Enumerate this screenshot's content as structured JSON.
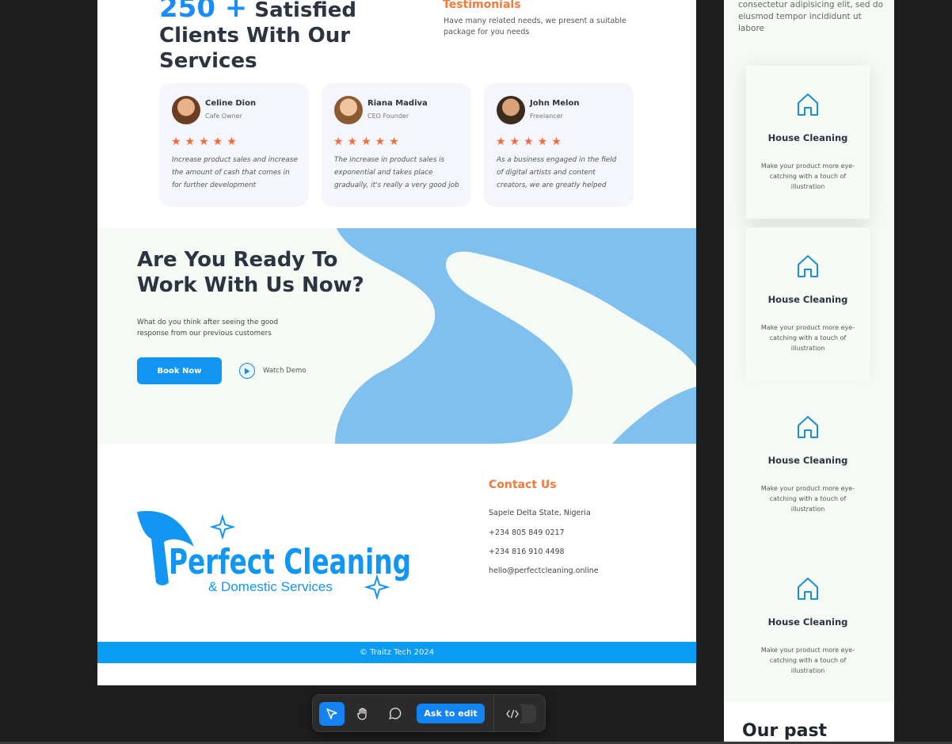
{
  "hero": {
    "count": "250 +",
    "title_rest": "Satisfied Clients With Our Services"
  },
  "testimonials": {
    "title": "Testimonials",
    "subtitle": "Have many related needs, we present a suitable package for you needs",
    "cards": [
      {
        "name": "Celine Dion",
        "role": "Cafe Owner",
        "stars": "★★★★★",
        "quote": "Increase product sales and increase the amount of cash that comes in for further development"
      },
      {
        "name": "Riana Madiva",
        "role": "CEO Founder",
        "stars": "★★★★★",
        "quote": "The increase in product sales is exponential and takes place gradually, it's really a very good job"
      },
      {
        "name": "John Melon",
        "role": "Freelancer",
        "stars": "★★★★★",
        "quote": "As a business engaged in the field of digital artists and content creators, we are greatly helped"
      }
    ]
  },
  "cta": {
    "title": "Are You Ready To Work With Us Now?",
    "subtitle": "What do you think after seeing the good response from our previous customers",
    "book_label": "Book Now",
    "watch_label": "Watch Demo"
  },
  "logo": {
    "main_text": "Perfect Cleaning",
    "sub_text": "& Domestic Services"
  },
  "contact": {
    "title": "Contact Us",
    "address": "Sapele Delta State, Nigeria",
    "phone1": "+234 805 849 0217",
    "phone2": "+234 816 910 4498",
    "email": "hello@perfectcleaning.online"
  },
  "footer": {
    "copyright": "© Traitz Tech 2024"
  },
  "side": {
    "intro": "consectetur adipisicing elit, sed do eiusmod tempor incididunt ut labore",
    "services": [
      {
        "title": "House Cleaning",
        "desc": "Make your product more eye-catching with a touch of illustration",
        "icon": "house-icon"
      },
      {
        "title": "House Cleaning",
        "desc": "Make your product more eye-catching with a touch of illustration",
        "icon": "house-icon"
      },
      {
        "title": "House Cleaning",
        "desc": "Make your product more eye-catching with a touch of illustration",
        "icon": "house-icon"
      },
      {
        "title": "House Cleaning",
        "desc": "Make your product more eye-catching with a touch of illustration",
        "icon": "house-icon"
      }
    ],
    "past_title": "Our past"
  },
  "toolbar": {
    "ask_label": "Ask to edit",
    "tools": [
      "cursor-icon",
      "hand-icon",
      "comment-icon"
    ],
    "code_icon": "code-icon"
  },
  "colors": {
    "brand_blue": "#1296f3",
    "accent_orange": "#f47a3a",
    "footer_blue": "#0a9cf5",
    "blob_blue": "#7fc0ee"
  }
}
